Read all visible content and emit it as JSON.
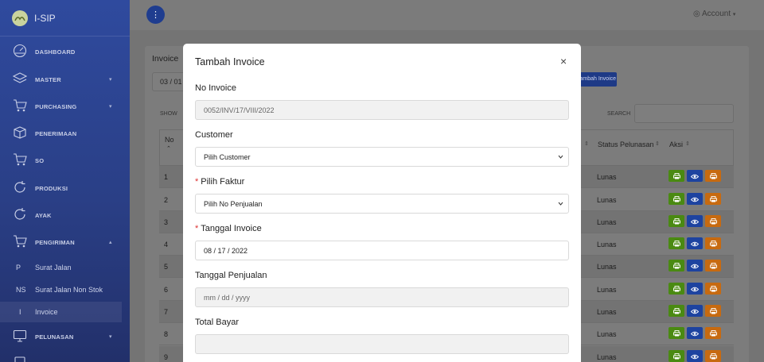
{
  "app": {
    "name": "I-SIP"
  },
  "sidebar": {
    "items": [
      {
        "label": "DASHBOARD",
        "icon": "dashboard-icon"
      },
      {
        "label": "MASTER",
        "icon": "layers-icon",
        "caret": "▾"
      },
      {
        "label": "PURCHASING",
        "icon": "cart-icon",
        "caret": "▾"
      },
      {
        "label": "PENERIMAAN",
        "icon": "box-icon"
      },
      {
        "label": "SO",
        "icon": "cart-icon"
      },
      {
        "label": "PRODUKSI",
        "icon": "refresh-icon"
      },
      {
        "label": "AYAK",
        "icon": "refresh-icon"
      },
      {
        "label": "PENGIRIMAN",
        "icon": "cart-icon",
        "caret": "▴"
      },
      {
        "label": "PELUNASAN",
        "icon": "monitor-icon",
        "caret": "▾"
      }
    ],
    "subitems": [
      {
        "abbr": "P",
        "label": "Surat Jalan"
      },
      {
        "abbr": "NS",
        "label": "Surat Jalan Non Stok"
      },
      {
        "abbr": "I",
        "label": "Invoice"
      }
    ]
  },
  "topbar": {
    "account": "Account"
  },
  "page": {
    "card_title": "Invoice",
    "date_filter": "03 / 01",
    "add_button": "Tambah Invoice",
    "show_label": "SHOW",
    "search_label": "SEARCH"
  },
  "table": {
    "headers": {
      "no": "No",
      "status": "Status Pelunasan",
      "aksi": "Aksi"
    },
    "rows": [
      {
        "no": "1",
        "status": "Lunas"
      },
      {
        "no": "2",
        "status": "Lunas"
      },
      {
        "no": "3",
        "status": "Lunas"
      },
      {
        "no": "4",
        "status": "Lunas"
      },
      {
        "no": "5",
        "status": "Lunas"
      },
      {
        "no": "6",
        "status": "Lunas"
      },
      {
        "no": "7",
        "status": "Lunas"
      },
      {
        "no": "8",
        "status": "Lunas"
      },
      {
        "no": "9",
        "status": "Lunas"
      }
    ]
  },
  "modal": {
    "title": "Tambah Invoice",
    "close": "×",
    "fields": {
      "no_invoice": {
        "label": "No Invoice",
        "value": "0052/INV/17/VIII/2022"
      },
      "customer": {
        "label": "Customer",
        "value": "Pilih Customer"
      },
      "faktur": {
        "label": "Pilih Faktur",
        "value": "Pilih No Penjualan"
      },
      "tanggal_invoice": {
        "label": "Tanggal Invoice",
        "value": "08 / 17 / 2022"
      },
      "tanggal_penjualan": {
        "label": "Tanggal Penjualan",
        "value": "mm / dd / yyyy"
      },
      "total_bayar": {
        "label": "Total Bayar",
        "value": ""
      }
    },
    "required_mark": "*"
  },
  "colors": {
    "primary": "#1f3d8f",
    "print_green": "#4a8a12",
    "view_blue": "#1d43a0",
    "print_orange": "#c76a10"
  }
}
